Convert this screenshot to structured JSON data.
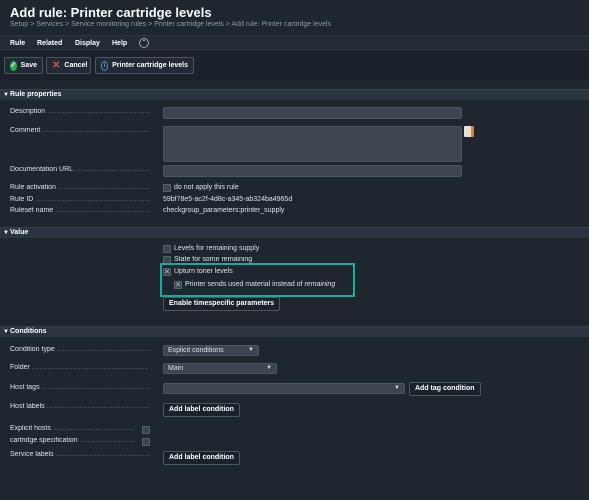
{
  "page": {
    "title": "Add rule: Printer cartridge levels",
    "breadcrumb": "Setup > Services > Service monitoring rules > Printer cartridge levels > Add rule: Printer cartridge levels"
  },
  "menu": {
    "items": [
      "Rule",
      "Related",
      "Display",
      "Help"
    ],
    "collapse_icon": "chevron-up-icon"
  },
  "toolbar": {
    "save_label": "Save",
    "cancel_label": "Cancel",
    "ruleset_label": "Printer cartridge levels"
  },
  "rule_properties": {
    "header": "Rule properties",
    "description_label": "Description",
    "description_value": "",
    "comment_label": "Comment",
    "comment_value": "",
    "doc_url_label": "Documentation URL",
    "doc_url_value": "",
    "activation_label": "Rule activation",
    "activation_option": "do not apply this rule",
    "activation_checked": false,
    "rule_id_label": "Rule ID",
    "rule_id_value": "59bf78e5-ac2f-4d8c-a345-ab324ba4965d",
    "ruleset_name_label": "Ruleset name",
    "ruleset_name_value": "checkgroup_parameters:printer_supply"
  },
  "value": {
    "header": "Value",
    "levels_label": "Levels for remaining supply",
    "levels_checked": false,
    "state_label": "State for some remaining",
    "state_checked": false,
    "upturn_label": "Upturn toner levels",
    "upturn_checked": true,
    "used_material_prefix": "Printer sends used material instead of",
    "used_material_emph": "remaining",
    "used_material_checked": true,
    "timespecific_button": "Enable timespecific parameters"
  },
  "conditions": {
    "header": "Conditions",
    "condition_type_label": "Condition type",
    "condition_type_value": "Explicit conditions",
    "folder_label": "Folder",
    "folder_value": "Main",
    "host_tags_label": "Host tags",
    "host_tags_value": "",
    "add_tag_button": "Add tag condition",
    "host_labels_label": "Host labels",
    "add_label_button": "Add label condition",
    "explicit_hosts_label": "Explicit hosts",
    "cartridge_spec_label": "cartridge specification",
    "service_labels_label": "Service labels",
    "add_service_label_button": "Add label condition"
  }
}
